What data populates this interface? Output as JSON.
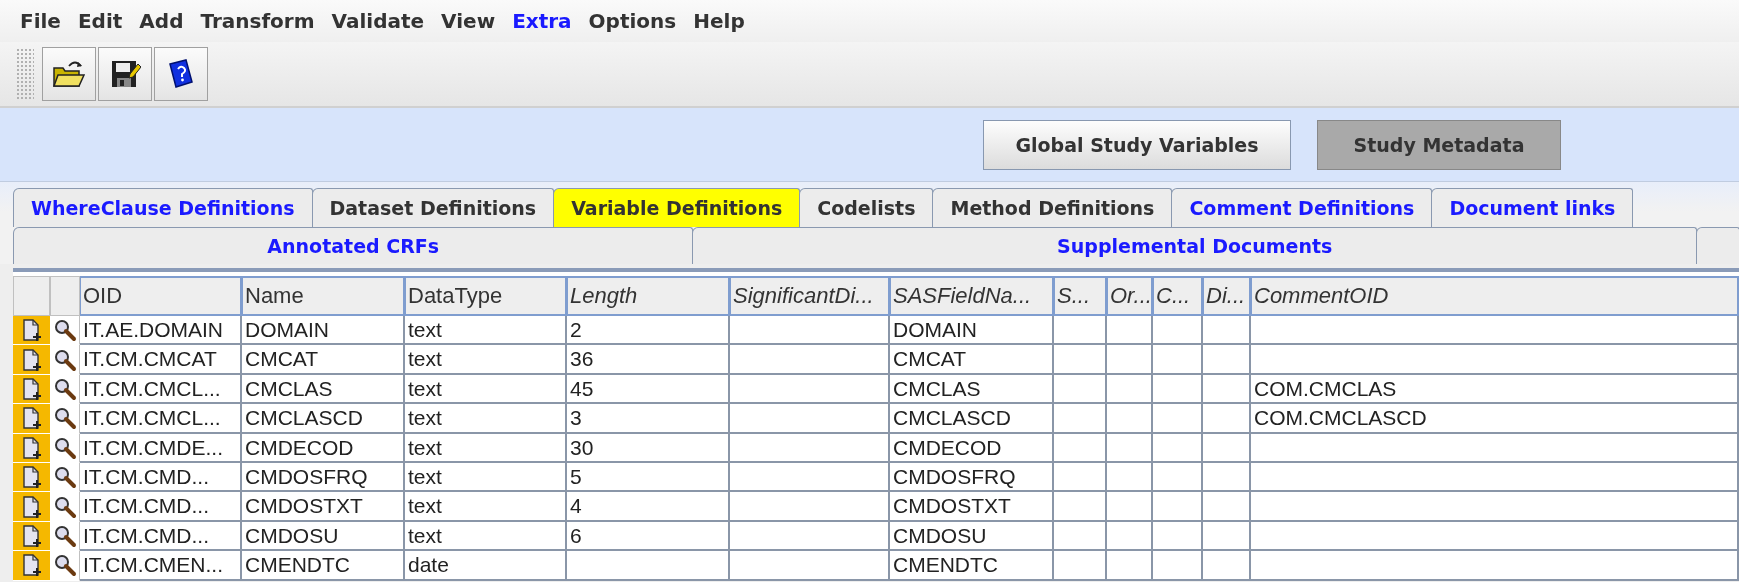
{
  "menu": [
    {
      "label": "File",
      "kind": "plain"
    },
    {
      "label": "Edit",
      "kind": "plain"
    },
    {
      "label": "Add",
      "kind": "plain"
    },
    {
      "label": "Transform",
      "kind": "plain"
    },
    {
      "label": "Validate",
      "kind": "plain"
    },
    {
      "label": "View",
      "kind": "plain"
    },
    {
      "label": "Extra",
      "kind": "link"
    },
    {
      "label": "Options",
      "kind": "plain"
    },
    {
      "label": "Help",
      "kind": "plain"
    }
  ],
  "toolbar": [
    {
      "kind": "open"
    },
    {
      "kind": "save"
    },
    {
      "kind": "help"
    }
  ],
  "view_buttons": [
    {
      "label": "Global Study Variables",
      "selected": false
    },
    {
      "label": "Study Metadata",
      "selected": true
    }
  ],
  "tab_rows": [
    [
      {
        "label": "WhereClause Definitions",
        "selected": false,
        "kind": "link"
      },
      {
        "label": "Dataset Definitions",
        "selected": false,
        "kind": "plain"
      },
      {
        "label": "Variable Definitions",
        "selected": true,
        "kind": "plain"
      },
      {
        "label": "Codelists",
        "selected": false,
        "kind": "plain"
      },
      {
        "label": "Method Definitions",
        "selected": false,
        "kind": "plain"
      },
      {
        "label": "Comment Definitions",
        "selected": false,
        "kind": "link"
      },
      {
        "label": "Document links",
        "selected": false,
        "kind": "link"
      }
    ],
    [
      {
        "label": "Annotated CRFs",
        "selected": false,
        "kind": "link"
      },
      {
        "label": "Supplemental Documents",
        "selected": false,
        "kind": "link"
      }
    ]
  ],
  "table": {
    "columns": [
      {
        "label": "OID",
        "italic": false
      },
      {
        "label": "Name",
        "italic": false
      },
      {
        "label": "DataType",
        "italic": false
      },
      {
        "label": "Length",
        "italic": true
      },
      {
        "label": "SignificantDi...",
        "italic": true
      },
      {
        "label": "SASFieldNa...",
        "italic": true
      },
      {
        "label": "S...",
        "italic": true
      },
      {
        "label": "Or...",
        "italic": true
      },
      {
        "label": "C...",
        "italic": true
      },
      {
        "label": "Di...",
        "italic": true
      },
      {
        "label": "CommentOID",
        "italic": true
      }
    ],
    "rows": [
      {
        "oid": "IT.AE.DOMAIN",
        "name": "DOMAIN",
        "datatype": "text",
        "length": "2",
        "sas_field_name": "DOMAIN"
      },
      {
        "oid": "IT.CM.CMCAT",
        "name": "CMCAT",
        "datatype": "text",
        "length": "36",
        "sas_field_name": "CMCAT"
      },
      {
        "oid": "IT.CM.CMCL...",
        "name": "CMCLAS",
        "datatype": "text",
        "length": "45",
        "sas_field_name": "CMCLAS",
        "comment_oid": "COM.CMCLAS"
      },
      {
        "oid": "IT.CM.CMCL...",
        "name": "CMCLASCD",
        "datatype": "text",
        "length": "3",
        "sas_field_name": "CMCLASCD",
        "comment_oid": "COM.CMCLASCD"
      },
      {
        "oid": "IT.CM.CMDE...",
        "name": "CMDECOD",
        "datatype": "text",
        "length": "30",
        "sas_field_name": "CMDECOD"
      },
      {
        "oid": "IT.CM.CMD...",
        "name": "CMDOSFRQ",
        "datatype": "text",
        "length": "5",
        "sas_field_name": "CMDOSFRQ"
      },
      {
        "oid": "IT.CM.CMD...",
        "name": "CMDOSTXT",
        "datatype": "text",
        "length": "4",
        "sas_field_name": "CMDOSTXT"
      },
      {
        "oid": "IT.CM.CMD...",
        "name": "CMDOSU",
        "datatype": "text",
        "length": "6",
        "sas_field_name": "CMDOSU"
      },
      {
        "oid": "IT.CM.CMEN...",
        "name": "CMENDTC",
        "datatype": "date",
        "sas_field_name": "CMENDTC"
      }
    ]
  }
}
